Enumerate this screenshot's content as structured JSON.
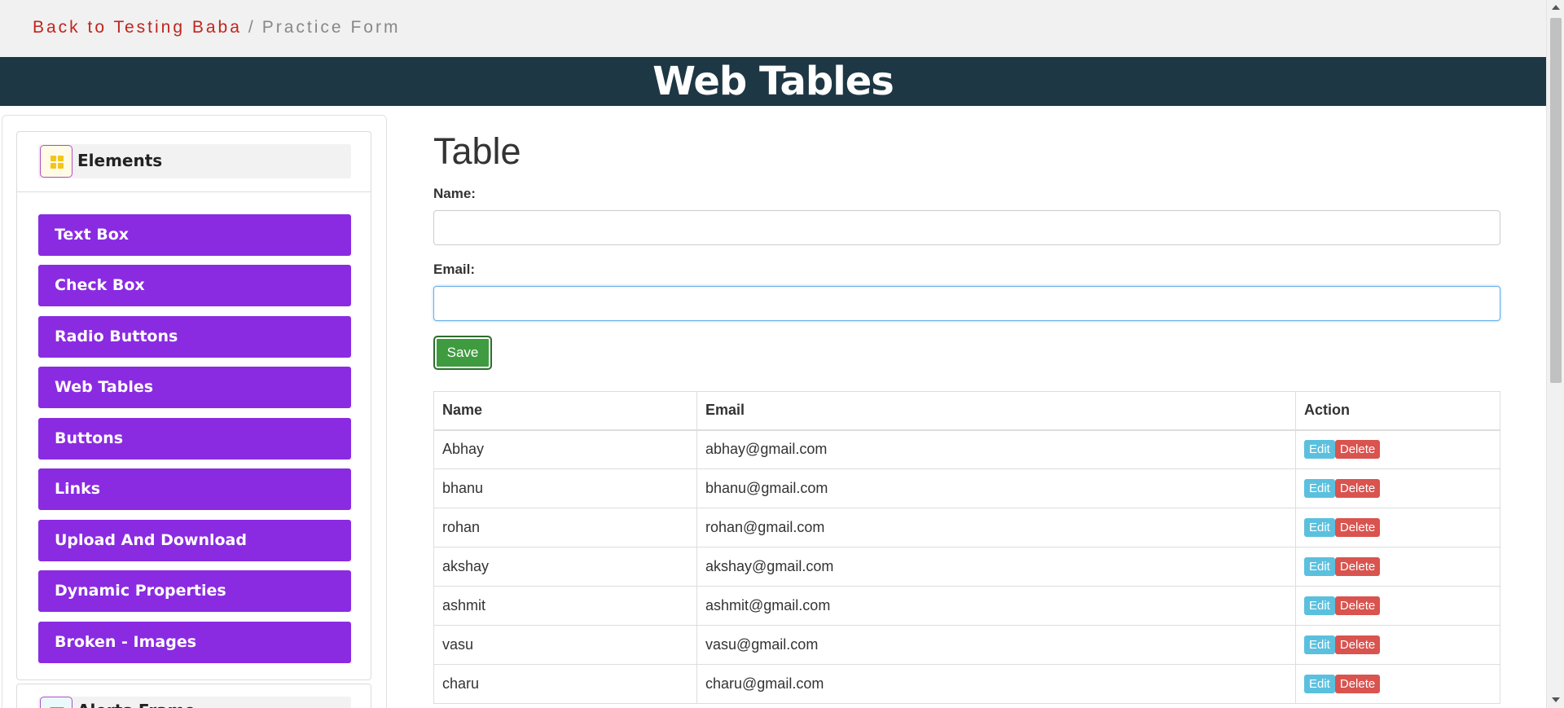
{
  "breadcrumb": {
    "home": "Back to Testing Baba",
    "separator": "/",
    "current": "Practice Form"
  },
  "banner": {
    "title": "Web Tables"
  },
  "sidebar": {
    "section_title": "Elements",
    "items": [
      {
        "label": "Text Box"
      },
      {
        "label": "Check Box"
      },
      {
        "label": "Radio Buttons"
      },
      {
        "label": "Web Tables"
      },
      {
        "label": "Buttons"
      },
      {
        "label": "Links"
      },
      {
        "label": "Upload And Download"
      },
      {
        "label": "Dynamic Properties"
      },
      {
        "label": "Broken - Images"
      }
    ],
    "next_section_title": "Alerts,Frame"
  },
  "form": {
    "title": "Table",
    "name_label": "Name:",
    "name_value": "",
    "email_label": "Email:",
    "email_value": "",
    "save_label": "Save"
  },
  "table": {
    "headers": [
      "Name",
      "Email",
      "Action"
    ],
    "edit_label": "Edit",
    "delete_label": "Delete",
    "rows": [
      {
        "name": "Abhay",
        "email": "abhay@gmail.com"
      },
      {
        "name": "bhanu",
        "email": "bhanu@gmail.com"
      },
      {
        "name": "rohan",
        "email": "rohan@gmail.com"
      },
      {
        "name": "akshay",
        "email": "akshay@gmail.com"
      },
      {
        "name": "ashmit",
        "email": "ashmit@gmail.com"
      },
      {
        "name": "vasu",
        "email": "vasu@gmail.com"
      },
      {
        "name": "charu",
        "email": "charu@gmail.com"
      }
    ]
  },
  "colors": {
    "banner_bg": "#1e3744",
    "sidebar_button": "#8a2be2",
    "save_button": "#3f9b40",
    "edit_button": "#5bc0de",
    "delete_button": "#d9534f",
    "breadcrumb_link": "#c0251d"
  }
}
